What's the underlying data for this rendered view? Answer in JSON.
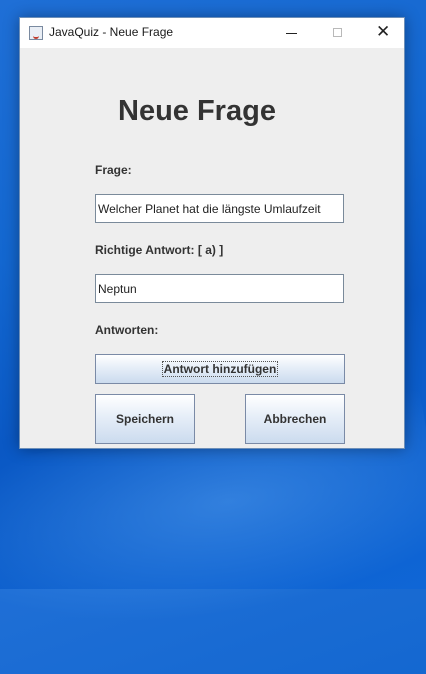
{
  "window": {
    "title": "JavaQuiz - Neue Frage",
    "controls": {
      "minimize": "—",
      "maximize": "☐",
      "close": "✕"
    }
  },
  "form": {
    "heading": "Neue Frage",
    "question_label": "Frage:",
    "question_value": "Welcher Planet hat die längste Umlaufzeit",
    "correct_answer_label": "Richtige Antwort: [ a) ]",
    "correct_answer_value": "Neptun",
    "answers_label": "Antworten:",
    "add_answer_button": "Antwort hinzufügen",
    "save_button": "Speichern",
    "cancel_button": "Abbrechen"
  },
  "colors": {
    "desktop_blue": "#1367d0",
    "window_bg": "#eeeeee",
    "button_gradient_bottom": "#cbdbee"
  },
  "icons": [
    "java-app-icon",
    "minimize-icon",
    "maximize-icon",
    "close-icon"
  ]
}
